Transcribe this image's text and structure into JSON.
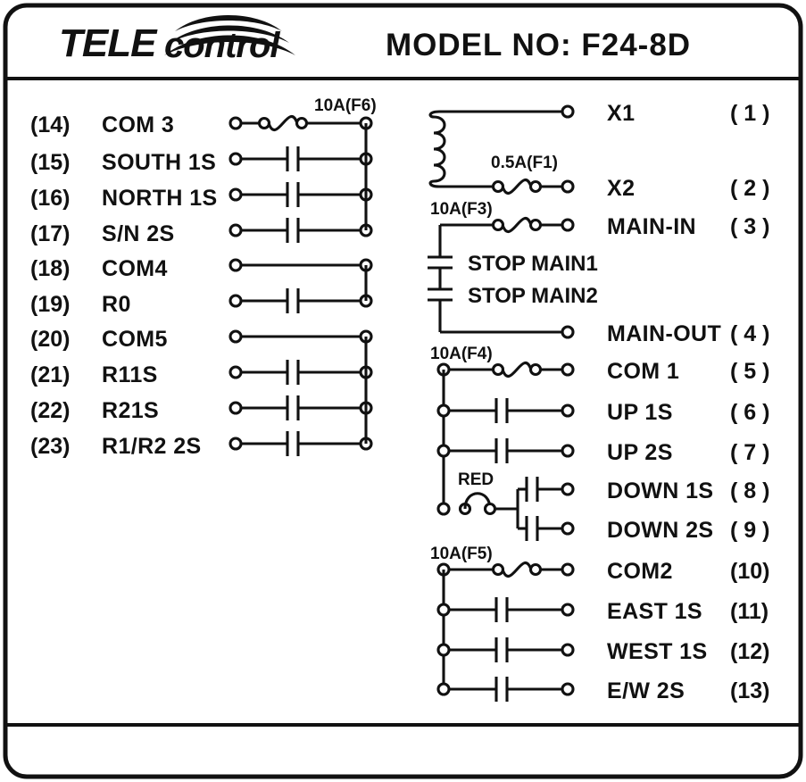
{
  "header": {
    "brand_tele": "TELE",
    "brand_control": "control",
    "brand_full": "TELEcontrol",
    "logo_icon": "signal-arcs-icon",
    "model_label": "MODEL NO: F24-8D"
  },
  "left_column": {
    "fuse_label": "10A(F6)",
    "rows": [
      {
        "num": "(14)",
        "name": "COM 3",
        "symbol": "fuse"
      },
      {
        "num": "(15)",
        "name": "SOUTH 1S",
        "symbol": "contact"
      },
      {
        "num": "(16)",
        "name": "NORTH 1S",
        "symbol": "contact"
      },
      {
        "num": "(17)",
        "name": "S/N 2S",
        "symbol": "contact"
      },
      {
        "num": "(18)",
        "name": "COM4",
        "symbol": "plain"
      },
      {
        "num": "(19)",
        "name": "R0",
        "symbol": "contact"
      },
      {
        "num": "(20)",
        "name": "COM5",
        "symbol": "plain"
      },
      {
        "num": "(21)",
        "name": "R11S",
        "symbol": "contact"
      },
      {
        "num": "(22)",
        "name": "R21S",
        "symbol": "contact"
      },
      {
        "num": "(23)",
        "name": "R1/R2 2S",
        "symbol": "contact"
      }
    ]
  },
  "right_column": {
    "fuses": {
      "f1": "0.5A(F1)",
      "f3": "10A(F3)",
      "f4": "10A(F4)",
      "f5": "10A(F5)"
    },
    "red_label": "RED",
    "stop_main_1": "STOP MAIN1",
    "stop_main_2": "STOP MAIN2",
    "rows": [
      {
        "num": "( 1 )",
        "name": "X1",
        "symbol": "coil-top"
      },
      {
        "num": "( 2 )",
        "name": "X2",
        "symbol": "coil-fuse"
      },
      {
        "num": "( 3 )",
        "name": "MAIN-IN",
        "symbol": "fuse"
      },
      {
        "num": "( 4 )",
        "name": "MAIN-OUT",
        "symbol": "plain"
      },
      {
        "num": "( 5 )",
        "name": "COM 1",
        "symbol": "fuse"
      },
      {
        "num": "( 6 )",
        "name": "UP 1S",
        "symbol": "contact"
      },
      {
        "num": "( 7 )",
        "name": "UP 2S",
        "symbol": "contact"
      },
      {
        "num": "( 8 )",
        "name": "DOWN 1S",
        "symbol": "red-branch"
      },
      {
        "num": "( 9 )",
        "name": "DOWN 2S",
        "symbol": "red-branch"
      },
      {
        "num": "(10)",
        "name": "COM2",
        "symbol": "fuse"
      },
      {
        "num": "(11)",
        "name": "EAST 1S",
        "symbol": "contact"
      },
      {
        "num": "(12)",
        "name": "WEST 1S",
        "symbol": "contact"
      },
      {
        "num": "(13)",
        "name": "E/W 2S",
        "symbol": "contact"
      }
    ]
  },
  "colors": {
    "ink": "#111111",
    "paper": "#ffffff"
  }
}
